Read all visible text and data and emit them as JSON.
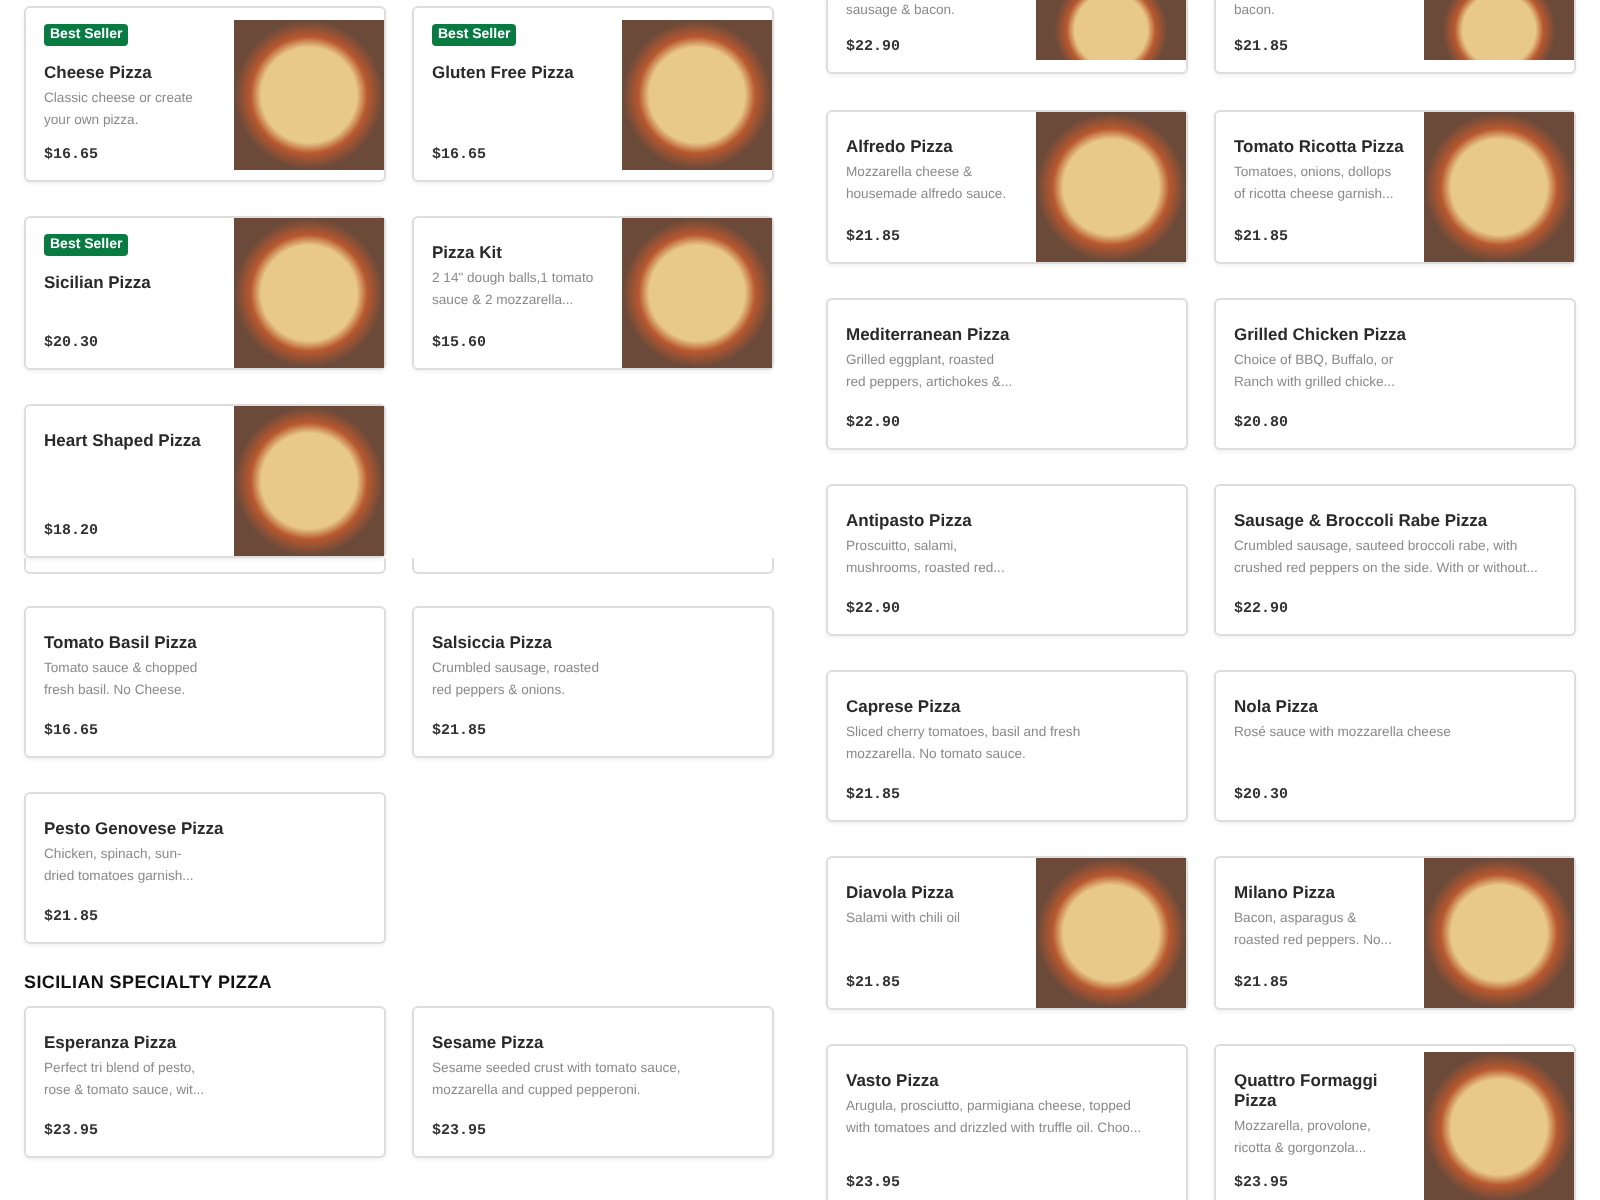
{
  "left_column": [
    {
      "kind": "cards",
      "cards": [
        {
          "badge": "Best Seller",
          "name": "Cheese Pizza",
          "description": "Classic cheese or create\nyour own pizza.",
          "price": "$16.65",
          "photo": true
        },
        {
          "badge": "Best Seller",
          "name": "Gluten Free Pizza",
          "price": "$16.65",
          "photo": true
        },
        {
          "badge": "Best Seller",
          "name": "Sicilian Pizza",
          "price": "$20.30",
          "photo": true
        },
        {
          "name": "Pizza Kit",
          "description": "2 14\" dough balls,1 tomato\nsauce & 2 mozzarella...",
          "price": "$15.60",
          "photo": true
        },
        {
          "name": "Heart Shaped Pizza",
          "price": "$18.20",
          "photo": true
        }
      ]
    },
    {
      "kind": "cut_row"
    },
    {
      "kind": "cards",
      "cards": [
        {
          "name": "Tomato Basil Pizza",
          "description": "Tomato sauce & chopped\nfresh basil. No Cheese.",
          "price": "$16.65",
          "photo": false
        },
        {
          "name": "Salsiccia Pizza",
          "description": "Crumbled sausage, roasted\nred peppers & onions.",
          "price": "$21.85",
          "photo": false
        },
        {
          "name": "Pesto Genovese Pizza",
          "description": "Chicken, spinach, sun-\ndried tomatoes garnish...",
          "price": "$21.85",
          "photo": false
        }
      ]
    },
    {
      "kind": "heading",
      "text": "SICILIAN SPECIALTY PIZZA"
    },
    {
      "kind": "cards",
      "cards": [
        {
          "name": "Esperanza Pizza",
          "description": "Perfect tri blend of pesto,\nrose & tomato sauce, wit...",
          "price": "$23.95",
          "photo": false
        },
        {
          "name": "Sesame Pizza",
          "description": "Sesame seeded crust with tomato sauce,\nmozzarella and cupped pepperoni.",
          "price": "$23.95",
          "photo": false
        }
      ]
    }
  ],
  "right_column": [
    {
      "kind": "partial_cards",
      "cards": [
        {
          "description": "sausage & bacon.",
          "price": "$22.90",
          "photo": true
        },
        {
          "description": "bacon.",
          "price": "$21.85",
          "photo": true
        }
      ]
    },
    {
      "kind": "cards",
      "cards": [
        {
          "name": "Alfredo Pizza",
          "description": "Mozzarella cheese &\nhousemade alfredo sauce.",
          "price": "$21.85",
          "photo": true
        },
        {
          "name": "Tomato Ricotta Pizza",
          "description": "Tomatoes, onions, dollops\nof ricotta cheese garnish...",
          "price": "$21.85",
          "photo": true
        },
        {
          "name": "Mediterranean Pizza",
          "description": "Grilled eggplant, roasted\nred peppers, artichokes &...",
          "price": "$22.90",
          "photo": false
        },
        {
          "name": "Grilled Chicken Pizza",
          "description": "Choice of BBQ, Buffalo, or\nRanch with grilled chicke...",
          "price": "$20.80",
          "photo": false
        },
        {
          "name": "Antipasto Pizza",
          "description": "Proscuitto, salami,\nmushrooms, roasted red...",
          "price": "$22.90",
          "photo": false
        },
        {
          "name": "Sausage & Broccoli Rabe Pizza",
          "description": "Crumbled sausage, sauteed broccoli rabe, with\ncrushed red peppers on the side. With or without...",
          "price": "$22.90",
          "photo": false
        },
        {
          "name": "Caprese Pizza",
          "description": "Sliced cherry tomatoes, basil and fresh\nmozzarella. No tomato sauce.",
          "price": "$21.85",
          "photo": false
        },
        {
          "name": "Nola Pizza",
          "description": "Rosé sauce with mozzarella cheese",
          "price": "$20.30",
          "photo": false
        },
        {
          "name": "Diavola Pizza",
          "description": "Salami with chili oil",
          "price": "$21.85",
          "photo": true
        },
        {
          "name": "Milano Pizza",
          "description": "Bacon, asparagus &\nroasted red peppers. No...",
          "price": "$21.85",
          "photo": true
        },
        {
          "name": "Vasto Pizza",
          "description": "Arugula, prosciutto, parmigiana cheese, topped\nwith tomatoes and drizzled with truffle oil. Choo...",
          "price": "$23.95",
          "photo": false
        },
        {
          "name": "Quattro Formaggi Pizza",
          "description": "Mozzarella, provolone,\nricotta & gorgonzola...",
          "price": "$23.95",
          "photo": true
        }
      ]
    }
  ]
}
